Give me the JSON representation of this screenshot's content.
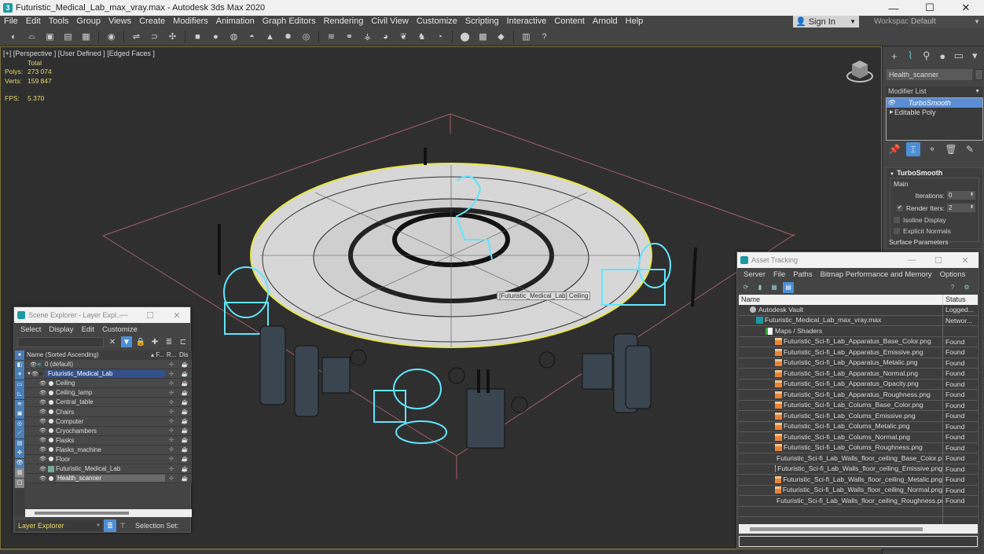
{
  "window": {
    "title": "Futuristic_Medical_Lab_max_vray.max - Autodesk 3ds Max 2020",
    "app_icon": "3ds-max-icon",
    "controls": [
      "minimize-icon",
      "maximize-icon",
      "close-icon"
    ],
    "control_glyphs": [
      "—",
      "☐",
      "✕"
    ]
  },
  "menu": [
    "File",
    "Edit",
    "Tools",
    "Group",
    "Views",
    "Create",
    "Modifiers",
    "Animation",
    "Graph Editors",
    "Rendering",
    "Civil View",
    "Customize",
    "Scripting",
    "Interactive",
    "Content",
    "Arnold",
    "Help"
  ],
  "account": {
    "sign_in": "Sign In",
    "workspaces_label": "Workspaces:",
    "workspace": "Default"
  },
  "toolbar": [
    {
      "name": "undo-icon",
      "g": "◐"
    },
    {
      "name": "redo-icon",
      "g": "⌓"
    },
    {
      "name": "hold-icon",
      "g": "▣"
    },
    {
      "name": "fetch-icon",
      "g": "▤"
    },
    {
      "name": "scene-states-icon",
      "g": "▦"
    },
    "|",
    {
      "name": "render-setup-icon",
      "g": "◉"
    },
    "|",
    {
      "name": "link-icon",
      "g": "⇌"
    },
    {
      "name": "unlink-icon",
      "g": "⊃"
    },
    {
      "name": "bind-spacewarp-icon",
      "g": "✣"
    },
    "|",
    {
      "name": "box-icon",
      "g": "■"
    },
    {
      "name": "sphere-icon",
      "g": "●"
    },
    {
      "name": "geosphere-icon",
      "g": "◍"
    },
    {
      "name": "torus-icon",
      "g": "◓"
    },
    {
      "name": "cone-icon",
      "g": "▲"
    },
    {
      "name": "light-icon",
      "g": "✹"
    },
    {
      "name": "camera-target-icon",
      "g": "◎"
    },
    "|",
    {
      "name": "wave-icon",
      "g": "≋"
    },
    {
      "name": "dynamics-icon",
      "g": "⚭"
    },
    {
      "name": "hierarchy-icon",
      "g": "⚶"
    },
    {
      "name": "globe-icon",
      "g": "◕"
    },
    {
      "name": "leaf-icon",
      "g": "❦"
    },
    {
      "name": "character-icon",
      "g": "♞"
    },
    {
      "name": "material-icon",
      "g": "◔"
    },
    "|",
    {
      "name": "material-editor-icon",
      "g": "⬤"
    },
    {
      "name": "render-frame-icon",
      "g": "▩"
    },
    {
      "name": "render-icon",
      "g": "◆"
    },
    "|",
    {
      "name": "viewport-layout-icon",
      "g": "▥"
    },
    {
      "name": "help-icon",
      "g": "?"
    }
  ],
  "viewport": {
    "label": "[+] [Perspective ] [User Defined ] [Edged Faces ]",
    "stats": {
      "header": "Total",
      "polys_label": "Polys:",
      "polys": "273 074",
      "verts_label": "Verts:",
      "verts": "159 847",
      "fps_label": "FPS:",
      "fps": "5.370"
    },
    "tooltip": "[Futuristic_Medical_Lab] Ceiling"
  },
  "command_panel": {
    "tabs": [
      {
        "name": "create-tab-icon",
        "g": "+"
      },
      {
        "name": "modify-tab-icon",
        "g": "⌇"
      },
      {
        "name": "hierarchy-tab-icon",
        "g": "⚲"
      },
      {
        "name": "motion-tab-icon",
        "g": "●"
      },
      {
        "name": "display-tab-icon",
        "g": "▭"
      },
      {
        "name": "utilities-tab-icon",
        "g": "▾"
      }
    ],
    "object_name": "Health_scanner",
    "modifier_list": "Modifier List",
    "stack": [
      "TurboSmooth",
      "Editable Poly"
    ],
    "stack_tools": [
      {
        "name": "pin-stack-icon",
        "g": "📌"
      },
      {
        "name": "show-end-result-icon",
        "g": "⌶"
      },
      {
        "name": "make-unique-icon",
        "g": "⚬"
      },
      {
        "name": "remove-modifier-icon",
        "g": "🗑"
      },
      {
        "name": "configure-sets-icon",
        "g": "✎"
      }
    ],
    "rollout": {
      "title": "TurboSmooth",
      "group": "Main",
      "iterations_label": "Iterations:",
      "iterations": "0",
      "render_iters_label": "Render Iters:",
      "render_iters": "2",
      "render_iters_checked": true,
      "isoline_label": "Isoline Display",
      "isoline_checked": false,
      "explicit_label": "Explicit Normals",
      "explicit_checked": false,
      "surface_label": "Surface Parameters"
    }
  },
  "scene_explorer": {
    "title": "Scene Explorer - Layer Expl...",
    "menu": [
      "Select",
      "Display",
      "Edit",
      "Customize"
    ],
    "columns": {
      "name": "Name (Sorted Ascending)",
      "freeze": "▴ F...",
      "render": "R...",
      "display": "Dis"
    },
    "rows": [
      {
        "label": "0 (default)",
        "level": 0,
        "type": "layer"
      },
      {
        "label": "Futuristic_Medical_Lab",
        "level": 0,
        "type": "layer-open",
        "highlight": true
      },
      {
        "label": "Ceiling",
        "level": 1,
        "type": "obj"
      },
      {
        "label": "Ceiling_lamp",
        "level": 1,
        "type": "obj"
      },
      {
        "label": "Central_table",
        "level": 1,
        "type": "obj"
      },
      {
        "label": "Chairs",
        "level": 1,
        "type": "obj"
      },
      {
        "label": "Computer",
        "level": 1,
        "type": "obj"
      },
      {
        "label": "Cryochambers",
        "level": 1,
        "type": "obj"
      },
      {
        "label": "Flasks",
        "level": 1,
        "type": "obj"
      },
      {
        "label": "Flasks_machine",
        "level": 1,
        "type": "obj"
      },
      {
        "label": "Floor",
        "level": 1,
        "type": "obj"
      },
      {
        "label": "Futuristic_Medical_Lab",
        "level": 1,
        "type": "group"
      },
      {
        "label": "Health_scanner",
        "level": 1,
        "type": "obj",
        "selected": true
      }
    ],
    "explorer_type": "Layer Explorer",
    "selection_set_label": "Selection Set:"
  },
  "asset_tracking": {
    "title": "Asset Tracking",
    "menu": [
      "Server",
      "File",
      "Paths",
      "Bitmap Performance and Memory",
      "Options"
    ],
    "columns": {
      "name": "Name",
      "status": "Status"
    },
    "rows": [
      {
        "name": "Autodesk Vault",
        "status": "Logged...",
        "icon": "vault",
        "level": 0
      },
      {
        "name": "Futuristic_Medical_Lab_max_vray.max",
        "status": "Networ...",
        "icon": "max",
        "level": 1
      },
      {
        "name": "Maps / Shaders",
        "status": "",
        "icon": "maps",
        "level": 2
      },
      {
        "name": "Futuristic_Sci-fi_Lab_Apparatus_Base_Color.png",
        "status": "Found",
        "icon": "png",
        "level": 3
      },
      {
        "name": "Futuristic_Sci-fi_Lab_Apparatus_Emissive.png",
        "status": "Found",
        "icon": "png",
        "level": 3
      },
      {
        "name": "Futuristic_Sci-fi_Lab_Apparatus_Metalic.png",
        "status": "Found",
        "icon": "png",
        "level": 3
      },
      {
        "name": "Futuristic_Sci-fi_Lab_Apparatus_Normal.png",
        "status": "Found",
        "icon": "png",
        "level": 3
      },
      {
        "name": "Futuristic_Sci-fi_Lab_Apparatus_Opacity.png",
        "status": "Found",
        "icon": "png",
        "level": 3
      },
      {
        "name": "Futuristic_Sci-fi_Lab_Apparatus_Roughness.png",
        "status": "Found",
        "icon": "png",
        "level": 3
      },
      {
        "name": "Futuristic_Sci-fi_Lab_Colums_Base_Color.png",
        "status": "Found",
        "icon": "png",
        "level": 3
      },
      {
        "name": "Futuristic_Sci-fi_Lab_Colums_Emissive.png",
        "status": "Found",
        "icon": "png",
        "level": 3
      },
      {
        "name": "Futuristic_Sci-fi_Lab_Colums_Metalic.png",
        "status": "Found",
        "icon": "png",
        "level": 3
      },
      {
        "name": "Futuristic_Sci-fi_Lab_Colums_Normal.png",
        "status": "Found",
        "icon": "png",
        "level": 3
      },
      {
        "name": "Futuristic_Sci-fi_Lab_Colums_Roughness.png",
        "status": "Found",
        "icon": "png",
        "level": 3
      },
      {
        "name": "Futuristic_Sci-fi_Lab_Walls_floor_ceiling_Base_Color.png",
        "status": "Found",
        "icon": "png",
        "level": 3
      },
      {
        "name": "Futuristic_Sci-fi_Lab_Walls_floor_ceiling_Emissive.png",
        "status": "Found",
        "icon": "png",
        "level": 3
      },
      {
        "name": "Futuristic_Sci-fi_Lab_Walls_floor_ceiling_Metalic.png",
        "status": "Found",
        "icon": "png",
        "level": 3
      },
      {
        "name": "Futuristic_Sci-fi_Lab_Walls_floor_ceiling_Normal.png",
        "status": "Found",
        "icon": "png",
        "level": 3
      },
      {
        "name": "Futuristic_Sci-fi_Lab_Walls_floor_ceiling_Roughness.png",
        "status": "Found",
        "icon": "png",
        "level": 3
      }
    ]
  },
  "colors": {
    "accent": "#4d8fd6",
    "stats_text": "#e8d86a",
    "selection_cyan": "#5fe6ff",
    "selected_yellow": "#e6e64a"
  }
}
